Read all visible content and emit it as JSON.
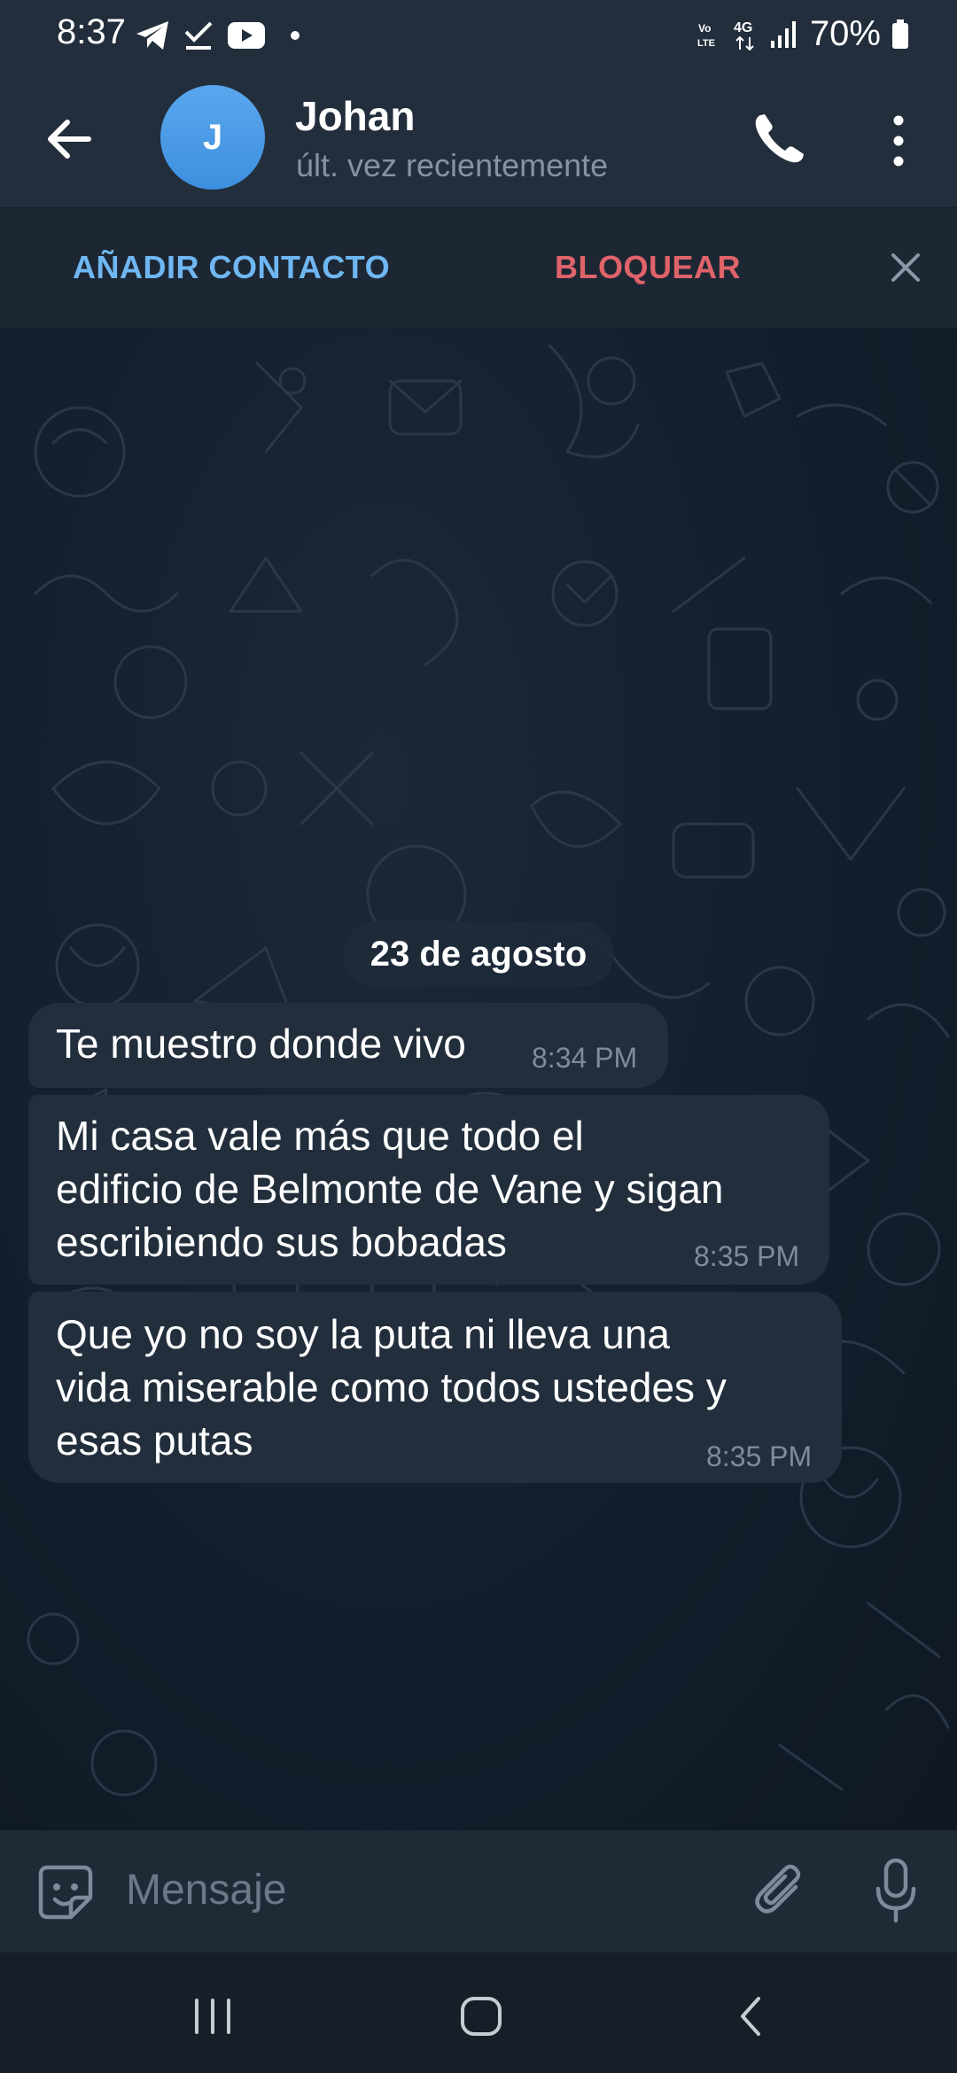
{
  "status_bar": {
    "time": "8:37",
    "battery": "70%",
    "network": "4G",
    "icons": [
      "telegram-icon",
      "check-icon",
      "youtube-icon",
      "notification-dot",
      "volte-icon",
      "network-4g-icon",
      "signal-icon",
      "battery-icon"
    ]
  },
  "header": {
    "back_icon": "arrow-left-icon",
    "avatar_letter": "J",
    "contact_name": "Johan",
    "contact_status": "últ. vez recientemente",
    "call_icon": "phone-icon",
    "menu_icon": "more-vertical-icon"
  },
  "action_bar": {
    "add_contact_label": "AÑADIR CONTACTO",
    "block_label": "BLOQUEAR",
    "close_icon": "close-icon"
  },
  "chat": {
    "date_label": "23 de agosto",
    "messages": [
      {
        "lines": [
          "Te muestro donde vivo"
        ],
        "time": "8:34 PM"
      },
      {
        "lines": [
          "Mi casa vale más que todo el",
          "edificio de Belmonte de Vane y sigan",
          "escribiendo sus bobadas"
        ],
        "time": "8:35 PM"
      },
      {
        "lines": [
          "Que yo no soy la puta ni lleva una",
          "vida miserable como todos ustedes y",
          "esas putas"
        ],
        "time": "8:35 PM"
      }
    ]
  },
  "composer": {
    "placeholder": "Mensaje",
    "emoji_icon": "sticker-icon",
    "attach_icon": "paperclip-icon",
    "mic_icon": "microphone-icon"
  },
  "nav_bar": {
    "icons": [
      "recent-apps-icon",
      "home-icon",
      "back-icon"
    ]
  },
  "colors": {
    "header_bg": "#232e3c",
    "chat_bg": "#0e1621",
    "bubble_bg": "#222e3c",
    "accent_blue": "#6fb7f2",
    "accent_red": "#e0636a",
    "avatar_blue": "#4a9be6"
  }
}
